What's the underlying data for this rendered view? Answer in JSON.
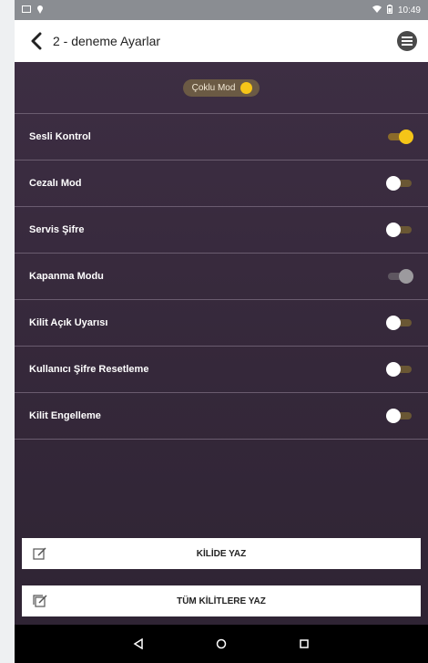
{
  "statusbar": {
    "time": "10:49"
  },
  "header": {
    "title": "2 - deneme Ayarlar"
  },
  "mode": {
    "label": "Çoklu Mod",
    "enabled": true
  },
  "settings": {
    "items": [
      {
        "label": "Sesli Kontrol",
        "state": "on"
      },
      {
        "label": "Cezalı Mod",
        "state": "off"
      },
      {
        "label": "Servis Şifre",
        "state": "off"
      },
      {
        "label": "Kapanma Modu",
        "state": "disabled"
      },
      {
        "label": "Kilit Açık Uyarısı",
        "state": "off"
      },
      {
        "label": "Kullanıcı Şifre Resetleme",
        "state": "off"
      },
      {
        "label": "Kilit Engelleme",
        "state": "off"
      }
    ]
  },
  "actions": {
    "write_lock_label": "KİLİDE YAZ",
    "write_all_label": "TÜM KİLİTLERE YAZ"
  },
  "colors": {
    "accent": "#f5c518",
    "background": "#3a2c3f"
  },
  "icons": {
    "back": "chevron-left-icon",
    "menu": "menu-icon",
    "edit": "edit-icon"
  }
}
